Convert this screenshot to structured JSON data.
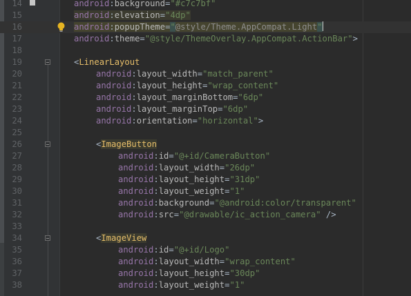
{
  "editor": {
    "lines": [
      {
        "n": "14",
        "marker": "bookmark",
        "parts": [
          {
            "t": "android",
            "c": "attr-ns"
          },
          {
            "t": ":",
            "c": "punc"
          },
          {
            "t": "background",
            "c": "attr-name"
          },
          {
            "t": "=",
            "c": "punc"
          },
          {
            "t": "\"#c7c7bf\"",
            "c": "str"
          }
        ],
        "indent": 1
      },
      {
        "n": "15",
        "parts": [
          {
            "t": "android",
            "c": "attr-ns elev-hl"
          },
          {
            "t": ":",
            "c": "punc elev-hl"
          },
          {
            "t": "elevation",
            "c": "attr-name elev-hl"
          },
          {
            "t": "=",
            "c": "punc elev-hl"
          },
          {
            "t": "\"4dp\"",
            "c": "str elev-hl"
          }
        ],
        "indent": 1
      },
      {
        "n": "16",
        "marker": "bulb",
        "current": true,
        "parts": [
          {
            "t": "android",
            "c": "attr-ns elev-hl-strong"
          },
          {
            "t": ":",
            "c": "punc elev-hl-strong"
          },
          {
            "t": "popupTheme",
            "c": "attr-name elev-hl-strong"
          },
          {
            "t": "=",
            "c": "punc elev-hl-strong"
          },
          {
            "t": "\"",
            "c": "str brace-hl"
          },
          {
            "t": "@style/Theme.AppCompat.Light",
            "c": "str-dim elev-hl-strong"
          },
          {
            "t": "\"",
            "c": "str brace-hl"
          }
        ],
        "indent": 1
      },
      {
        "n": "17",
        "parts": [
          {
            "t": "android",
            "c": "attr-ns"
          },
          {
            "t": ":",
            "c": "punc"
          },
          {
            "t": "theme",
            "c": "attr-name"
          },
          {
            "t": "=",
            "c": "punc"
          },
          {
            "t": "\"@style/ThemeOverlay.AppCompat.ActionBar\"",
            "c": "str"
          },
          {
            "t": ">",
            "c": "punc"
          }
        ],
        "indent": 1
      },
      {
        "n": "18",
        "parts": [],
        "indent": 0
      },
      {
        "n": "19",
        "fold": true,
        "parts": [
          {
            "t": "<",
            "c": "punc"
          },
          {
            "t": "LinearLayout",
            "c": "tag"
          }
        ],
        "indent": 1
      },
      {
        "n": "20",
        "parts": [
          {
            "t": "android",
            "c": "attr-ns"
          },
          {
            "t": ":",
            "c": "punc"
          },
          {
            "t": "layout_width",
            "c": "attr-name"
          },
          {
            "t": "=",
            "c": "punc"
          },
          {
            "t": "\"match_parent\"",
            "c": "str"
          }
        ],
        "indent": 2
      },
      {
        "n": "21",
        "parts": [
          {
            "t": "android",
            "c": "attr-ns"
          },
          {
            "t": ":",
            "c": "punc"
          },
          {
            "t": "layout_height",
            "c": "attr-name"
          },
          {
            "t": "=",
            "c": "punc"
          },
          {
            "t": "\"wrap_content\"",
            "c": "str"
          }
        ],
        "indent": 2
      },
      {
        "n": "22",
        "parts": [
          {
            "t": "android",
            "c": "attr-ns"
          },
          {
            "t": ":",
            "c": "punc"
          },
          {
            "t": "layout_marginBottom",
            "c": "attr-name"
          },
          {
            "t": "=",
            "c": "punc"
          },
          {
            "t": "\"6dp\"",
            "c": "str"
          }
        ],
        "indent": 2
      },
      {
        "n": "23",
        "parts": [
          {
            "t": "android",
            "c": "attr-ns"
          },
          {
            "t": ":",
            "c": "punc"
          },
          {
            "t": "layout_marginTop",
            "c": "attr-name"
          },
          {
            "t": "=",
            "c": "punc"
          },
          {
            "t": "\"6dp\"",
            "c": "str"
          }
        ],
        "indent": 2
      },
      {
        "n": "24",
        "parts": [
          {
            "t": "android",
            "c": "attr-ns"
          },
          {
            "t": ":",
            "c": "punc"
          },
          {
            "t": "orientation",
            "c": "attr-name"
          },
          {
            "t": "=",
            "c": "punc"
          },
          {
            "t": "\"horizontal\"",
            "c": "str"
          },
          {
            "t": ">",
            "c": "punc"
          }
        ],
        "indent": 2
      },
      {
        "n": "25",
        "parts": [],
        "indent": 0
      },
      {
        "n": "26",
        "fold": true,
        "parts": [
          {
            "t": "<",
            "c": "punc"
          },
          {
            "t": "ImageButton",
            "c": "tag-hl"
          }
        ],
        "indent": 2
      },
      {
        "n": "27",
        "parts": [
          {
            "t": "android",
            "c": "attr-ns"
          },
          {
            "t": ":",
            "c": "punc"
          },
          {
            "t": "id",
            "c": "attr-name"
          },
          {
            "t": "=",
            "c": "punc"
          },
          {
            "t": "\"@+id/CameraButton\"",
            "c": "str"
          }
        ],
        "indent": 3
      },
      {
        "n": "28",
        "parts": [
          {
            "t": "android",
            "c": "attr-ns"
          },
          {
            "t": ":",
            "c": "punc"
          },
          {
            "t": "layout_width",
            "c": "attr-name"
          },
          {
            "t": "=",
            "c": "punc"
          },
          {
            "t": "\"26dp\"",
            "c": "str"
          }
        ],
        "indent": 3
      },
      {
        "n": "29",
        "parts": [
          {
            "t": "android",
            "c": "attr-ns"
          },
          {
            "t": ":",
            "c": "punc"
          },
          {
            "t": "layout_height",
            "c": "attr-name"
          },
          {
            "t": "=",
            "c": "punc"
          },
          {
            "t": "\"31dp\"",
            "c": "str"
          }
        ],
        "indent": 3
      },
      {
        "n": "30",
        "parts": [
          {
            "t": "android",
            "c": "attr-ns"
          },
          {
            "t": ":",
            "c": "punc"
          },
          {
            "t": "layout_weight",
            "c": "attr-name"
          },
          {
            "t": "=",
            "c": "punc"
          },
          {
            "t": "\"1\"",
            "c": "str"
          }
        ],
        "indent": 3
      },
      {
        "n": "31",
        "parts": [
          {
            "t": "android",
            "c": "attr-ns"
          },
          {
            "t": ":",
            "c": "punc"
          },
          {
            "t": "background",
            "c": "attr-name"
          },
          {
            "t": "=",
            "c": "punc"
          },
          {
            "t": "\"@android:color/transparent\"",
            "c": "str"
          }
        ],
        "indent": 3
      },
      {
        "n": "32",
        "parts": [
          {
            "t": "android",
            "c": "attr-ns"
          },
          {
            "t": ":",
            "c": "punc"
          },
          {
            "t": "src",
            "c": "attr-name"
          },
          {
            "t": "=",
            "c": "punc"
          },
          {
            "t": "\"@drawable/ic_action_camera\"",
            "c": "str"
          },
          {
            "t": " />",
            "c": "punc"
          }
        ],
        "indent": 3
      },
      {
        "n": "33",
        "parts": [],
        "indent": 0
      },
      {
        "n": "34",
        "fold": true,
        "parts": [
          {
            "t": "<",
            "c": "punc"
          },
          {
            "t": "ImageView",
            "c": "tag-hl"
          }
        ],
        "indent": 2
      },
      {
        "n": "35",
        "parts": [
          {
            "t": "android",
            "c": "attr-ns"
          },
          {
            "t": ":",
            "c": "punc"
          },
          {
            "t": "id",
            "c": "attr-name"
          },
          {
            "t": "=",
            "c": "punc"
          },
          {
            "t": "\"@+id/Logo\"",
            "c": "str"
          }
        ],
        "indent": 3
      },
      {
        "n": "36",
        "parts": [
          {
            "t": "android",
            "c": "attr-ns"
          },
          {
            "t": ":",
            "c": "punc"
          },
          {
            "t": "layout_width",
            "c": "attr-name"
          },
          {
            "t": "=",
            "c": "punc"
          },
          {
            "t": "\"wrap_content\"",
            "c": "str"
          }
        ],
        "indent": 3
      },
      {
        "n": "37",
        "parts": [
          {
            "t": "android",
            "c": "attr-ns"
          },
          {
            "t": ":",
            "c": "punc"
          },
          {
            "t": "layout_height",
            "c": "attr-name"
          },
          {
            "t": "=",
            "c": "punc"
          },
          {
            "t": "\"30dp\"",
            "c": "str"
          }
        ],
        "indent": 3
      },
      {
        "n": "38",
        "parts": [
          {
            "t": "android",
            "c": "attr-ns"
          },
          {
            "t": ":",
            "c": "punc"
          },
          {
            "t": "layout_weight",
            "c": "attr-name"
          },
          {
            "t": "=",
            "c": "punc"
          },
          {
            "t": "\"1\"",
            "c": "str"
          }
        ],
        "indent": 3
      }
    ]
  },
  "colors": {
    "background": "#2b2b2b",
    "gutter": "#313335",
    "line_number": "#606366",
    "attr_namespace": "#9876aa",
    "attr_name": "#bababa",
    "string": "#6a8759",
    "tag": "#e8bf6a"
  },
  "icons": {
    "bookmark": "bookmark-icon",
    "bulb": "lightbulb-icon",
    "fold": "fold-marker-icon"
  }
}
